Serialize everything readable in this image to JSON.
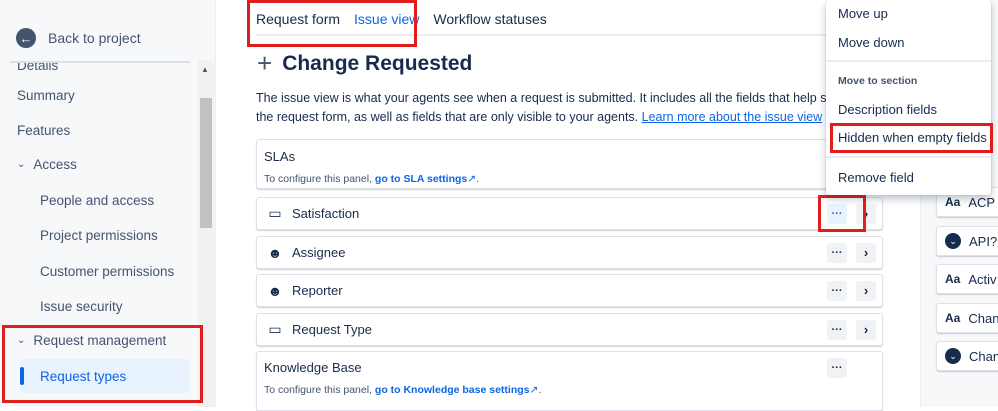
{
  "sidebar": {
    "back_label": "Back to project",
    "items": [
      {
        "label": "Details"
      },
      {
        "label": "Summary"
      },
      {
        "label": "Features"
      },
      {
        "label": "Access"
      },
      {
        "label": "People and access"
      },
      {
        "label": "Project permissions"
      },
      {
        "label": "Customer permissions"
      },
      {
        "label": "Issue security"
      },
      {
        "label": "Request management"
      },
      {
        "label": "Request types"
      }
    ]
  },
  "tabs": [
    "Request form",
    "Issue view",
    "Workflow statuses"
  ],
  "title": "Change Requested",
  "description": {
    "line1": "The issue view is what your agents see when a request is submitted. It includes all the fields that help seel",
    "line2": "the request form, as well as fields that are only visible to your agents.",
    "link": "Learn more about the issue view"
  },
  "sla": {
    "label": "SLAs",
    "sub": "To configure this panel,",
    "link": "go to SLA settings"
  },
  "fields": [
    {
      "name": "Satisfaction",
      "icon": "rectangle-icon"
    },
    {
      "name": "Assignee",
      "icon": "user-icon"
    },
    {
      "name": "Reporter",
      "icon": "user-icon"
    },
    {
      "name": "Request Type",
      "icon": "rectangle-icon"
    }
  ],
  "kb": {
    "label": "Knowledge Base",
    "sub": "To configure this panel,",
    "link": "go to Knowledge base settings"
  },
  "menu": {
    "move_up": "Move up",
    "move_down": "Move down",
    "section_heading": "Move to section",
    "description_fields": "Description fields",
    "hidden_when_empty": "Hidden when empty fields",
    "remove": "Remove field"
  },
  "right_fields": [
    {
      "icon": "Aa",
      "name": "ACP r"
    },
    {
      "icon": "dropdown",
      "name": "API?"
    },
    {
      "icon": "Aa",
      "name": "Activ"
    },
    {
      "icon": "Aa",
      "name": "Chan"
    },
    {
      "icon": "dropdown",
      "name": "Chan"
    }
  ],
  "colors": {
    "accent": "#0c66e4",
    "highlight": "#e01e1e"
  }
}
